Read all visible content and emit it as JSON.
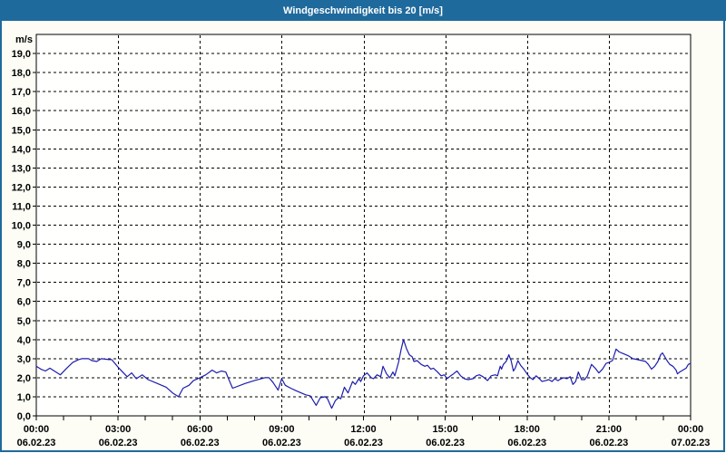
{
  "window": {
    "title": "Windgeschwindigkeit bis 20 [m/s]"
  },
  "colors": {
    "titlebar_bg": "#1f6a9c",
    "window_border": "#1f6a9c",
    "background": "#fdfdf6",
    "plot_background": "#fffffd",
    "grid": "#000000",
    "axis": "#000000",
    "text": "#000000",
    "line": "#1c1cb0"
  },
  "chart_data": {
    "type": "line",
    "title": "Windgeschwindigkeit bis 20 [m/s]",
    "ylabel": "m/s",
    "ylim": [
      0,
      20
    ],
    "ytick_step": 1,
    "ytick_labels": [
      "0,0",
      "1,0",
      "2,0",
      "3,0",
      "4,0",
      "5,0",
      "6,0",
      "7,0",
      "8,0",
      "9,0",
      "10,0",
      "11,0",
      "12,0",
      "13,0",
      "14,0",
      "15,0",
      "16,0",
      "17,0",
      "18,0",
      "19,0"
    ],
    "xlim_minutes": [
      0,
      1440
    ],
    "x_minor_tick_minutes": 60,
    "grid": "dashed",
    "legend": "none",
    "x_major_ticks": [
      {
        "minutes": 0,
        "time": "00:00",
        "date": "06.02.23"
      },
      {
        "minutes": 180,
        "time": "03:00",
        "date": "06.02.23"
      },
      {
        "minutes": 360,
        "time": "06:00",
        "date": "06.02.23"
      },
      {
        "minutes": 540,
        "time": "09:00",
        "date": "06.02.23"
      },
      {
        "minutes": 720,
        "time": "12:00",
        "date": "06.02.23"
      },
      {
        "minutes": 900,
        "time": "15:00",
        "date": "06.02.23"
      },
      {
        "minutes": 1080,
        "time": "18:00",
        "date": "06.02.23"
      },
      {
        "minutes": 1260,
        "time": "21:00",
        "date": "06.02.23"
      },
      {
        "minutes": 1440,
        "time": "00:00",
        "date": "07.02.23"
      }
    ],
    "series": [
      {
        "name": "Windgeschwindigkeit",
        "unit": "m/s",
        "points": [
          [
            0,
            2.6
          ],
          [
            10,
            2.45
          ],
          [
            20,
            2.35
          ],
          [
            30,
            2.5
          ],
          [
            53,
            2.15
          ],
          [
            67,
            2.5
          ],
          [
            80,
            2.8
          ],
          [
            93,
            2.95
          ],
          [
            100,
            3.0
          ],
          [
            115,
            3.0
          ],
          [
            122,
            2.9
          ],
          [
            133,
            2.85
          ],
          [
            143,
            3.0
          ],
          [
            160,
            2.95
          ],
          [
            166,
            2.95
          ],
          [
            180,
            2.55
          ],
          [
            200,
            2.05
          ],
          [
            210,
            2.25
          ],
          [
            220,
            1.95
          ],
          [
            233,
            2.15
          ],
          [
            246,
            1.9
          ],
          [
            266,
            1.7
          ],
          [
            286,
            1.5
          ],
          [
            300,
            1.2
          ],
          [
            313,
            1.0
          ],
          [
            323,
            1.45
          ],
          [
            336,
            1.6
          ],
          [
            346,
            1.85
          ],
          [
            360,
            2.0
          ],
          [
            373,
            2.15
          ],
          [
            387,
            2.4
          ],
          [
            397,
            2.25
          ],
          [
            407,
            2.35
          ],
          [
            417,
            2.3
          ],
          [
            423,
            1.95
          ],
          [
            432,
            1.45
          ],
          [
            460,
            1.7
          ],
          [
            480,
            1.85
          ],
          [
            503,
            2.0
          ],
          [
            512,
            2.0
          ],
          [
            521,
            1.75
          ],
          [
            532,
            1.35
          ],
          [
            540,
            1.95
          ],
          [
            548,
            1.6
          ],
          [
            560,
            1.45
          ],
          [
            573,
            1.3
          ],
          [
            583,
            1.2
          ],
          [
            593,
            1.1
          ],
          [
            603,
            1.05
          ],
          [
            616,
            0.55
          ],
          [
            625,
            0.95
          ],
          [
            636,
            1.0
          ],
          [
            641,
            0.9
          ],
          [
            650,
            0.4
          ],
          [
            658,
            0.8
          ],
          [
            665,
            0.95
          ],
          [
            670,
            0.9
          ],
          [
            678,
            1.5
          ],
          [
            686,
            1.2
          ],
          [
            696,
            1.8
          ],
          [
            702,
            1.65
          ],
          [
            710,
            1.95
          ],
          [
            714,
            1.8
          ],
          [
            720,
            2.1
          ],
          [
            728,
            2.25
          ],
          [
            737,
            2.0
          ],
          [
            742,
            1.95
          ],
          [
            750,
            2.15
          ],
          [
            758,
            2.05
          ],
          [
            763,
            2.6
          ],
          [
            771,
            2.2
          ],
          [
            778,
            2.0
          ],
          [
            785,
            2.3
          ],
          [
            789,
            2.1
          ],
          [
            797,
            2.8
          ],
          [
            803,
            3.5
          ],
          [
            808,
            4.0
          ],
          [
            815,
            3.5
          ],
          [
            821,
            3.2
          ],
          [
            827,
            3.1
          ],
          [
            831,
            2.85
          ],
          [
            838,
            2.9
          ],
          [
            847,
            2.7
          ],
          [
            855,
            2.6
          ],
          [
            861,
            2.65
          ],
          [
            868,
            2.45
          ],
          [
            874,
            2.5
          ],
          [
            883,
            2.3
          ],
          [
            891,
            2.1
          ],
          [
            898,
            2.15
          ],
          [
            904,
            1.95
          ],
          [
            912,
            2.1
          ],
          [
            918,
            2.2
          ],
          [
            926,
            2.35
          ],
          [
            934,
            2.1
          ],
          [
            942,
            1.95
          ],
          [
            950,
            1.9
          ],
          [
            961,
            1.95
          ],
          [
            968,
            2.1
          ],
          [
            975,
            2.15
          ],
          [
            983,
            2.05
          ],
          [
            993,
            1.85
          ],
          [
            1001,
            2.1
          ],
          [
            1010,
            2.15
          ],
          [
            1015,
            2.1
          ],
          [
            1021,
            2.6
          ],
          [
            1024,
            2.45
          ],
          [
            1028,
            2.7
          ],
          [
            1034,
            2.85
          ],
          [
            1040,
            3.2
          ],
          [
            1045,
            2.9
          ],
          [
            1050,
            2.35
          ],
          [
            1054,
            2.5
          ],
          [
            1060,
            2.9
          ],
          [
            1066,
            2.65
          ],
          [
            1073,
            2.45
          ],
          [
            1080,
            2.2
          ],
          [
            1087,
            2.0
          ],
          [
            1093,
            1.9
          ],
          [
            1100,
            2.1
          ],
          [
            1107,
            1.95
          ],
          [
            1113,
            1.8
          ],
          [
            1121,
            1.85
          ],
          [
            1128,
            1.9
          ],
          [
            1135,
            1.8
          ],
          [
            1141,
            1.95
          ],
          [
            1148,
            1.85
          ],
          [
            1155,
            1.95
          ],
          [
            1161,
            2.0
          ],
          [
            1168,
            1.95
          ],
          [
            1175,
            2.05
          ],
          [
            1181,
            1.65
          ],
          [
            1187,
            1.8
          ],
          [
            1193,
            2.3
          ],
          [
            1200,
            1.9
          ],
          [
            1207,
            1.9
          ],
          [
            1213,
            2.1
          ],
          [
            1222,
            2.7
          ],
          [
            1230,
            2.5
          ],
          [
            1238,
            2.25
          ],
          [
            1246,
            2.45
          ],
          [
            1254,
            2.75
          ],
          [
            1260,
            2.8
          ],
          [
            1268,
            2.9
          ],
          [
            1276,
            3.5
          ],
          [
            1283,
            3.35
          ],
          [
            1293,
            3.25
          ],
          [
            1303,
            3.15
          ],
          [
            1313,
            3.0
          ],
          [
            1323,
            2.95
          ],
          [
            1333,
            2.9
          ],
          [
            1341,
            2.85
          ],
          [
            1347,
            2.7
          ],
          [
            1354,
            2.45
          ],
          [
            1361,
            2.6
          ],
          [
            1368,
            2.85
          ],
          [
            1374,
            3.2
          ],
          [
            1378,
            3.3
          ],
          [
            1383,
            3.1
          ],
          [
            1388,
            2.9
          ],
          [
            1394,
            2.7
          ],
          [
            1401,
            2.6
          ],
          [
            1408,
            2.4
          ],
          [
            1411,
            2.2
          ],
          [
            1416,
            2.3
          ],
          [
            1423,
            2.4
          ],
          [
            1430,
            2.5
          ],
          [
            1435,
            2.7
          ],
          [
            1440,
            2.75
          ]
        ]
      }
    ]
  }
}
